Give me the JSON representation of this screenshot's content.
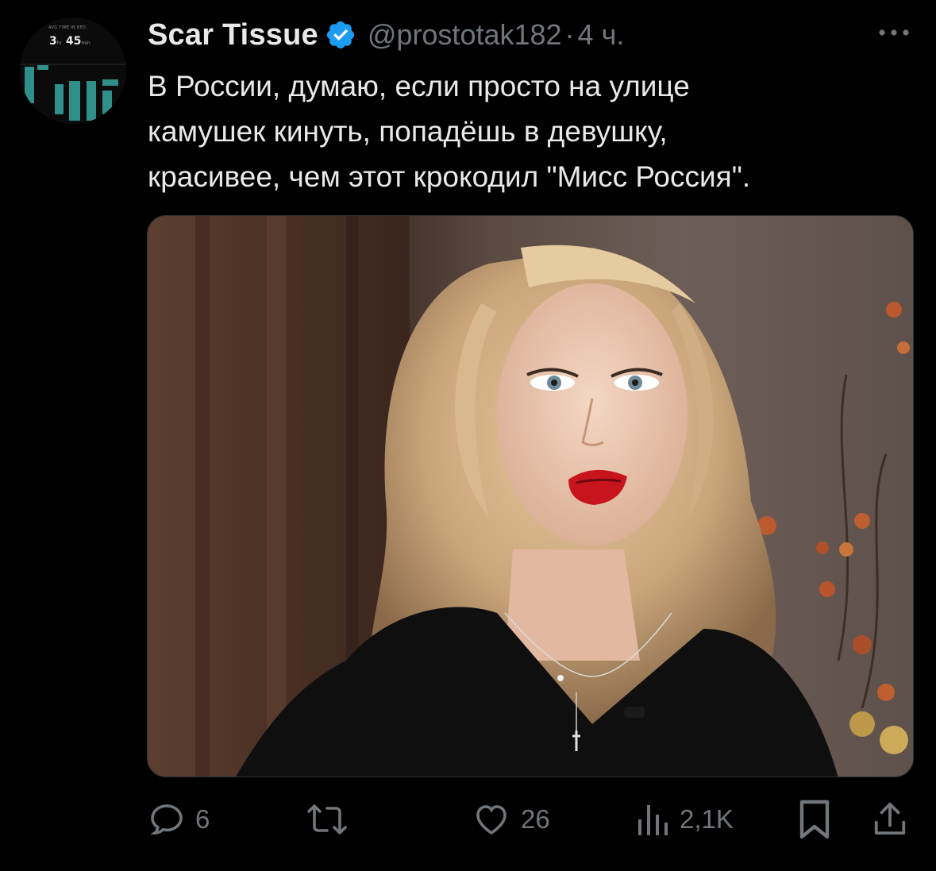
{
  "author": {
    "display_name": "Scar Tissue",
    "handle": "@prostotak182",
    "separator": "·",
    "time_ago": "4 ч.",
    "verified_icon": "verified-badge-icon",
    "accent_color": "#1d9bf0"
  },
  "avatar": {
    "caption": "AVG TIME IN BED",
    "hours": "3",
    "hours_unit": "hr",
    "minutes": "45",
    "minutes_unit": "min"
  },
  "tweet": {
    "lines": [
      "В России, думаю, если просто на улице",
      "камушек кинуть, попадёшь в девушку,",
      "красивее, чем этот крокодил \"Мисс Россия\"."
    ]
  },
  "actions": {
    "reply": {
      "icon": "reply-icon",
      "count": "6"
    },
    "repost": {
      "icon": "repost-icon",
      "count": ""
    },
    "like": {
      "icon": "heart-icon",
      "count": "26"
    },
    "views": {
      "icon": "views-icon",
      "count": "2,1K"
    },
    "bookmark": {
      "icon": "bookmark-icon"
    },
    "share": {
      "icon": "share-icon"
    }
  }
}
